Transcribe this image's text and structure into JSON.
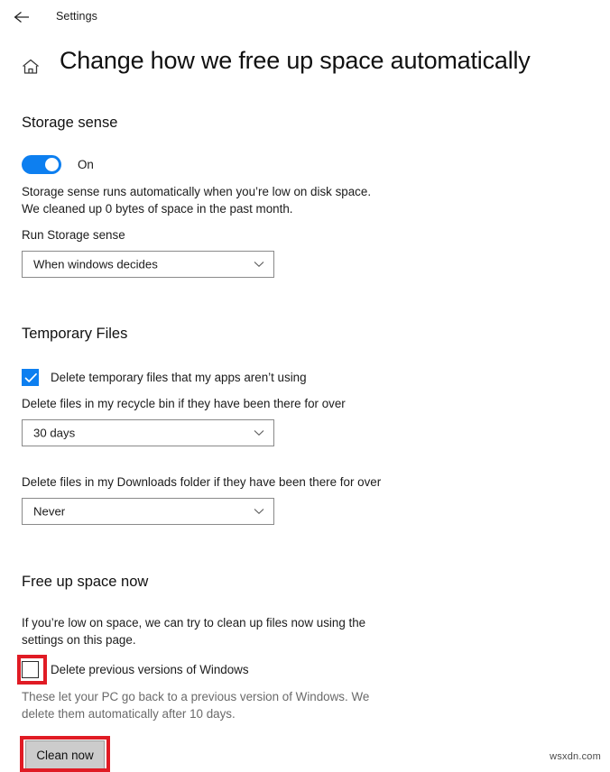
{
  "titlebar": {
    "back_icon": "back-arrow-icon",
    "label": "Settings"
  },
  "header": {
    "home_icon": "home-icon",
    "title": "Change how we free up space automatically"
  },
  "storage_sense": {
    "heading": "Storage sense",
    "toggle": {
      "state_label": "On",
      "enabled": true,
      "accent_color": "#0d7ff0"
    },
    "description_line1": "Storage sense runs automatically when you’re low on disk space.",
    "description_line2": "We cleaned up 0 bytes of space in the past month.",
    "run_label": "Run Storage sense",
    "run_dropdown": {
      "value": "When windows decides",
      "chevron_icon": "chevron-down-icon"
    }
  },
  "temporary_files": {
    "heading": "Temporary Files",
    "temp_checkbox": {
      "label": "Delete temporary files that my apps aren’t using",
      "checked": true
    },
    "recycle_label": "Delete files in my recycle bin if they have been there for over",
    "recycle_dropdown": {
      "value": "30 days",
      "chevron_icon": "chevron-down-icon"
    },
    "downloads_label": "Delete files in my Downloads folder if they have been there for over",
    "downloads_dropdown": {
      "value": "Never",
      "chevron_icon": "chevron-down-icon"
    }
  },
  "free_up_space": {
    "heading": "Free up space now",
    "description_line1": "If you’re low on space, we can try to clean up files now using the",
    "description_line2": "settings on this page.",
    "previous_versions_checkbox": {
      "label": "Delete previous versions of Windows",
      "checked": false,
      "highlight_color": "#e01b24"
    },
    "note_line1": "These let your PC go back to a previous version of Windows. We",
    "note_line2": "delete them automatically after 10 days.",
    "clean_button": {
      "label": "Clean now",
      "highlight_color": "#e01b24"
    }
  },
  "watermark": "wsxdn.com"
}
